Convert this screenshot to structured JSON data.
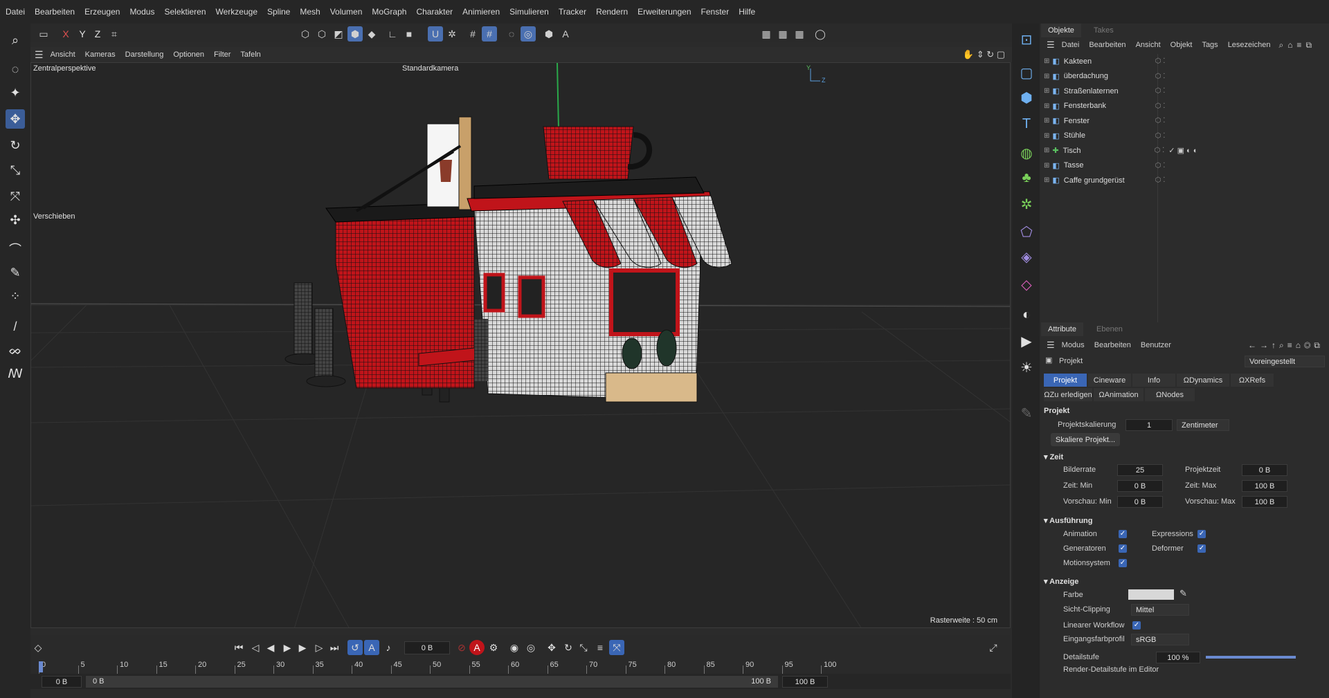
{
  "menubar": {
    "items": [
      "Datei",
      "Bearbeiten",
      "Erzeugen",
      "Modus",
      "Selektieren",
      "Werkzeuge",
      "Spline",
      "Mesh",
      "Volumen",
      "MoGraph",
      "Charakter",
      "Animieren",
      "Simulieren",
      "Tracker",
      "Rendern",
      "Erweiterungen",
      "Fenster",
      "Hilfe"
    ]
  },
  "toolbar": {
    "axis_x": "X",
    "axis_y": "Y",
    "axis_z": "Z"
  },
  "viewport_menu": {
    "items": [
      "Ansicht",
      "Kameras",
      "Darstellung",
      "Optionen",
      "Filter",
      "Tafeln"
    ]
  },
  "viewport": {
    "projection": "Zentralperspektive",
    "camera": "Standardkamera",
    "tool_label": "Verschieben",
    "grid_info": "Rasterweite : 50 cm",
    "accent": "#c0141a",
    "wire": "#0a0a0a"
  },
  "objects_panel": {
    "tabs": [
      "Objekte",
      "Takes"
    ],
    "menu": [
      "Datei",
      "Bearbeiten",
      "Ansicht",
      "Objekt",
      "Tags",
      "Lesezeichen"
    ],
    "items": [
      "Kakteen",
      "überdachung",
      "Straßenlaternen",
      "Fensterbank",
      "Fenster",
      "Stühle",
      "Tisch",
      "Tasse",
      "Caffe grundgerüst"
    ]
  },
  "attributes_panel": {
    "tabs": [
      "Attribute",
      "Ebenen"
    ],
    "menu": [
      "Modus",
      "Bearbeiten",
      "Benutzer"
    ],
    "object": "Projekt",
    "preset": "Voreingestellt",
    "subtabs_row1": [
      "Projekt",
      "Cineware",
      "Info",
      "Dynamics",
      "XRefs"
    ],
    "subtabs_row2": [
      "Zu erledigen",
      "Animation",
      "Nodes"
    ],
    "section_title": "Projekt",
    "scale_label": "Projektskalierung",
    "scale_value": "1",
    "scale_unit": "Zentimeter",
    "scale_button": "Skaliere Projekt...",
    "zeit": {
      "title": "Zeit",
      "bildrate_label": "Bilderrate",
      "bildrate": "25",
      "projektzeit_label": "Projektzeit",
      "projektzeit": "0 B",
      "zeitmin_label": "Zeit: Min",
      "zeitmin": "0 B",
      "zeitmax_label": "Zeit: Max",
      "zeitmax": "100 B",
      "vmin_label": "Vorschau: Min",
      "vmin": "0 B",
      "vmax_label": "Vorschau: Max",
      "vmax": "100 B"
    },
    "ausfuehrung": {
      "title": "Ausführung",
      "animation": "Animation",
      "expressions": "Expressions",
      "generatoren": "Generatoren",
      "deformer": "Deformer",
      "motion": "Motionsystem"
    },
    "anzeige": {
      "title": "Anzeige",
      "farbe": "Farbe",
      "sicht_label": "Sicht-Clipping",
      "sicht_value": "Mittel",
      "linear": "Linearer Workflow",
      "eingang_label": "Eingangsfarbprofil",
      "eingang_value": "sRGB",
      "detail_label": "Detailstufe",
      "detail_value": "100 %",
      "detail_fraction": 1.0,
      "render_detail": "Render-Detailstufe im Editor"
    }
  },
  "timeline": {
    "current_frame": "0 B",
    "ticks": [
      "0",
      "5",
      "10",
      "15",
      "20",
      "25",
      "30",
      "35",
      "40",
      "45",
      "50",
      "55",
      "60",
      "65",
      "70",
      "75",
      "80",
      "85",
      "90",
      "95",
      "100"
    ],
    "range_start": "0 B",
    "range_start2": "0 B",
    "range_end": "100 B",
    "range_end2": "100 B"
  }
}
